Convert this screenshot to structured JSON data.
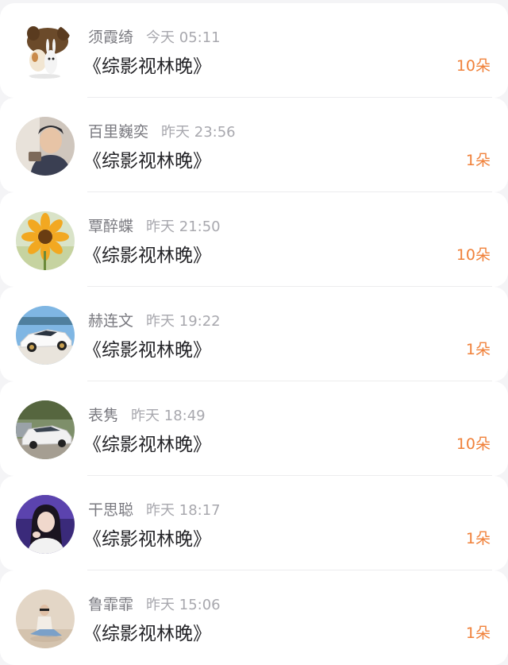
{
  "items": [
    {
      "name": "须霞绮",
      "time": "今天 05:11",
      "title": "《综影视林晚》",
      "count": "10朵",
      "avatar": "dog-bunny-cartoon-avatar"
    },
    {
      "name": "百里巍奕",
      "time": "昨天 23:56",
      "title": "《综影视林晚》",
      "count": "1朵",
      "avatar": "man-portrait-avatar"
    },
    {
      "name": "覃醉蝶",
      "time": "昨天 21:50",
      "title": "《综影视林晚》",
      "count": "10朵",
      "avatar": "sunflower-avatar"
    },
    {
      "name": "赫连文",
      "time": "昨天 19:22",
      "title": "《综影视林晚》",
      "count": "1朵",
      "avatar": "white-sports-car-avatar"
    },
    {
      "name": "表隽",
      "time": "昨天 18:49",
      "title": "《综影视林晚》",
      "count": "10朵",
      "avatar": "parked-car-avatar"
    },
    {
      "name": "干思聪",
      "time": "昨天 18:17",
      "title": "《综影视林晚》",
      "count": "1朵",
      "avatar": "woman-purple-avatar"
    },
    {
      "name": "鲁霏霏",
      "time": "昨天 15:06",
      "title": "《综影视林晚》",
      "count": "1朵",
      "avatar": "sitting-figure-avatar"
    }
  ],
  "colors": {
    "accent": "#f0813a",
    "name_text": "#7a7a80",
    "time_text": "#a8a8ae",
    "title_text": "#222226"
  }
}
